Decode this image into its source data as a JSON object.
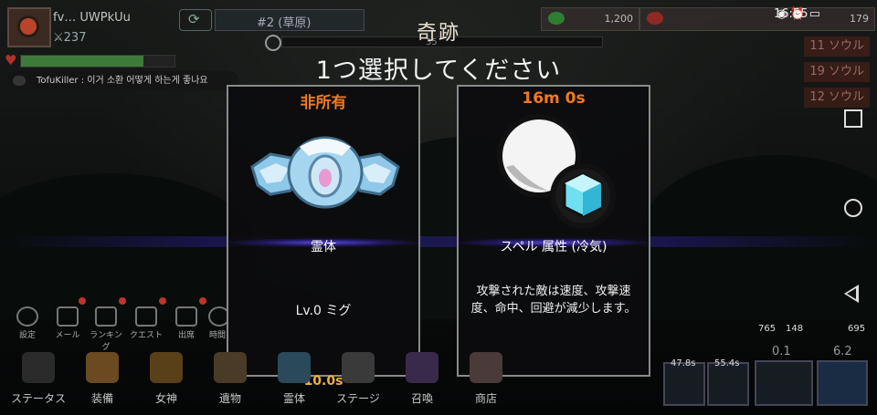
{
  "hud": {
    "player_name": "fv… UWPkUu",
    "power": "237",
    "stage_label": "#2 (草原)",
    "resource_green": "1,200",
    "resource_right": "179",
    "progress_number": "35",
    "time": "16:55",
    "chat_message": "TofuKiller : 이거 소환 어떻게 하는게 좋나요",
    "hp_fraction": 0.8
  },
  "souls": [
    "11 ソウル",
    "19 ソウル",
    "12 ソウル"
  ],
  "dialog": {
    "title": "奇跡",
    "subtitle": "1つ選択してください",
    "timer": "10.0s"
  },
  "cards": [
    {
      "header": "非所有",
      "name": "霊体",
      "detail": "Lv.0 ミグ",
      "icon": "spirit-wings-icon"
    },
    {
      "header": "16m 0s",
      "name": "スペル 属性 (冷気)",
      "detail": "攻撃された敵は速度、攻撃速度、命中、回避が減少します。",
      "icon": "ice-orb-icon"
    }
  ],
  "top_menu": [
    "設定",
    "メール",
    "ランキング",
    "クエスト",
    "出席",
    "時間"
  ],
  "bottom_menu": [
    "ステータス",
    "装備",
    "女神",
    "遺物",
    "霊体",
    "ステージ",
    "召喚",
    "商店"
  ],
  "side_stats": {
    "a": "765",
    "b": "148",
    "c": "0.1",
    "d": "695",
    "e": "6.2",
    "slot1_time": "47.8s",
    "slot2_time": "55.4s"
  },
  "colors": {
    "header_orange": "#f07a20",
    "timer_gold": "#f0b040",
    "glow_purple": "#5a3cff"
  }
}
